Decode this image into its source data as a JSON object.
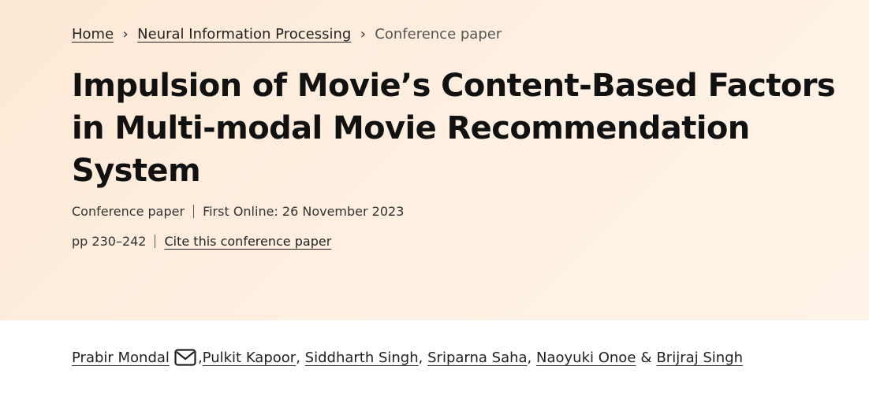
{
  "breadcrumb": {
    "home": "Home",
    "section": "Neural Information Processing",
    "current": "Conference paper",
    "separator": "›"
  },
  "title": "Impulsion of Movie’s Content-Based Factors in Multi-modal Movie Recommendation System",
  "meta": {
    "type": "Conference paper",
    "first_online": "First Online: 26 November 2023",
    "pages": "pp 230–242",
    "cite_link": "Cite this conference paper"
  },
  "authors": {
    "list": [
      "Prabir Mondal",
      "Pulkit Kapoor",
      "Siddharth Singh",
      "Sriparna Saha",
      "Naoyuki Onoe",
      "Brijraj Singh"
    ],
    "contact_icon": "envelope-icon",
    "comma": ",",
    "ampersand": "&"
  },
  "colors": {
    "hero_background": "#fde8d4",
    "text": "#222222"
  }
}
